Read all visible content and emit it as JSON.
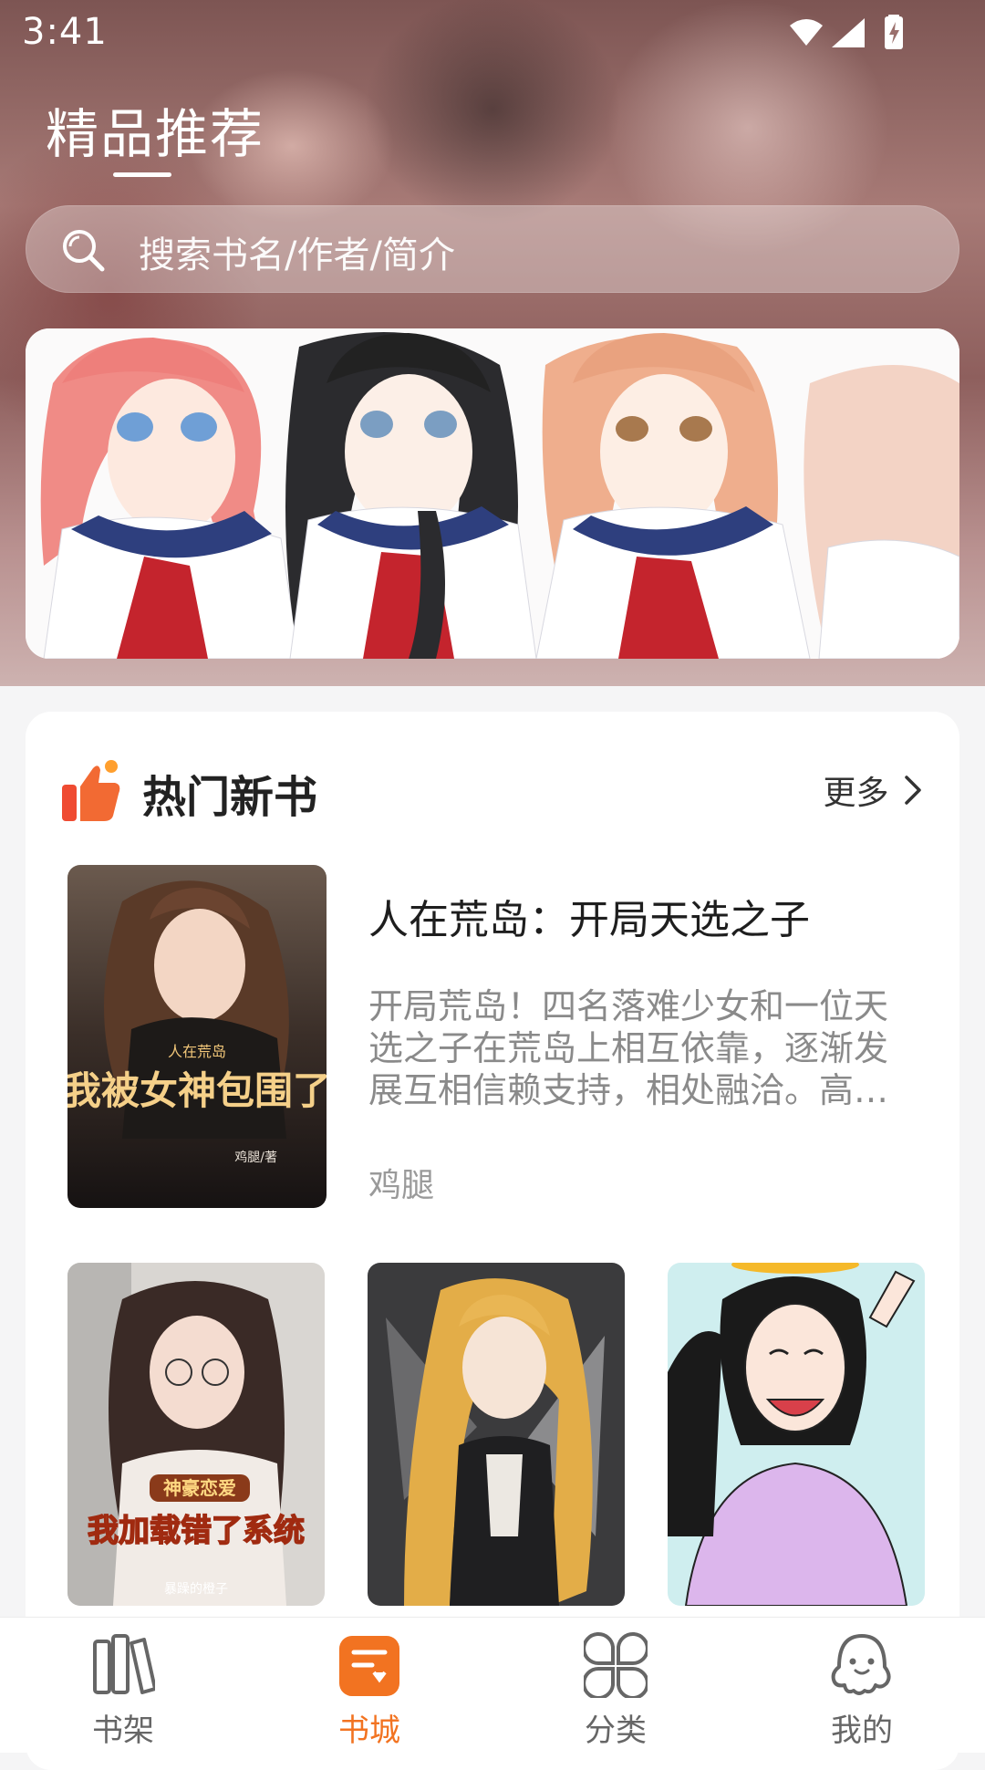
{
  "status_bar": {
    "time": "3:41"
  },
  "header": {
    "title": "精品推荐"
  },
  "search": {
    "placeholder": "搜索书名/作者/简介"
  },
  "banner": {
    "description": "anime-girls-banner"
  },
  "section": {
    "title": "热门新书",
    "more_label": "更多"
  },
  "featured_book": {
    "title": "人在荒岛：开局天选之子",
    "description": "开局荒岛！四名落难少女和一位天选之子在荒岛上相互依靠，逐渐发展互相信赖支持，相处融洽。高…",
    "author": "鸡腿",
    "cover_text": "我被女神包围了",
    "cover_small": "人在荒岛",
    "cover_author": "鸡腿/著"
  },
  "books_row": [
    {
      "cover_tag": "神豪恋爱",
      "cover_title": "我加载错了系统",
      "cover_author": "暴躁的橙子"
    },
    {
      "cover_tag": "",
      "cover_title": "",
      "cover_author": ""
    },
    {
      "cover_tag": "",
      "cover_title": "",
      "cover_author": ""
    }
  ],
  "tabs": [
    {
      "label": "书架",
      "icon": "bookshelf-icon"
    },
    {
      "label": "书城",
      "icon": "bookstore-icon",
      "active": true
    },
    {
      "label": "分类",
      "icon": "category-icon"
    },
    {
      "label": "我的",
      "icon": "profile-icon"
    }
  ],
  "colors": {
    "accent": "#f27321",
    "title": "#222222",
    "muted": "#8a8a8a"
  }
}
